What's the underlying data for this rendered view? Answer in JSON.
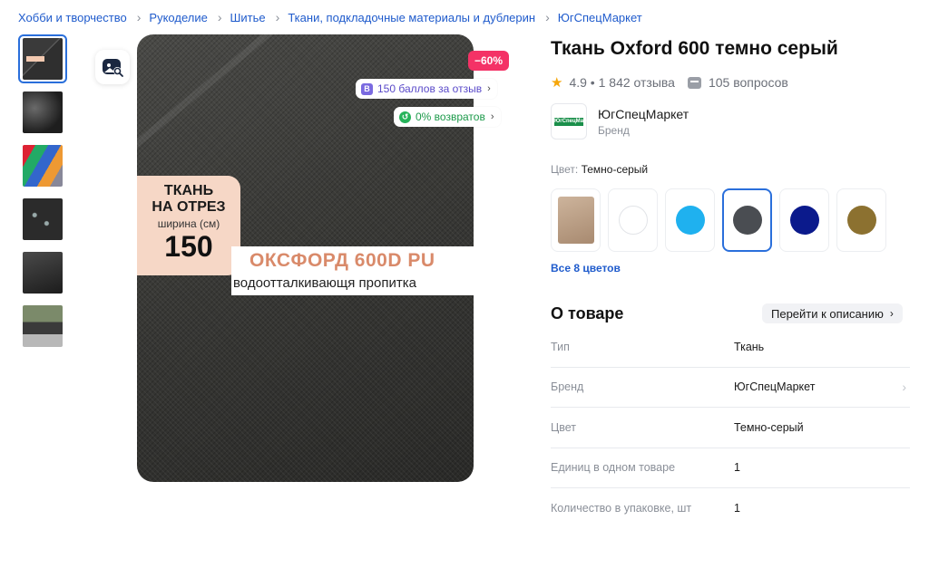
{
  "breadcrumb": [
    "Хобби и творчество",
    "Рукоделие",
    "Шитье",
    "Ткани, подкладочные материалы и дублерин",
    "ЮгСпецМаркет"
  ],
  "gallery": {
    "image_text": {
      "promo_line1": "ТКАНЬ",
      "promo_line2": "НА ОТРЕЗ",
      "promo_width_label": "ширина (см)",
      "promo_width_value": "150",
      "banner_title": "ОКСФОРД 600D PU",
      "banner_subtitle": "водоотталкивающя пропитка"
    },
    "discount": "−60%",
    "bonus_pill": "150 баллов за отзыв",
    "bonus_icon": "В",
    "returns_pill": "0% возвратов"
  },
  "product": {
    "title": "Ткань Oxford 600 темно серый",
    "rating": "4.9",
    "reviews": "1 842 отзыва",
    "questions": "105 вопросов",
    "brand_name": "ЮгСпецМаркет",
    "brand_sub": "Бренд",
    "brand_logo_text": "ЮгСпецМаркет"
  },
  "colors": {
    "label": "Цвет:",
    "selected": "Темно-серый",
    "swatches": [
      "#c9ab8f",
      "#ffffff",
      "#1fb1ef",
      "#4a4d52",
      "#0b1a8c",
      "#8c7130"
    ],
    "all_colors": "Все 8 цветов"
  },
  "about": {
    "title": "О товаре",
    "goto": "Перейти к описанию",
    "specs": [
      {
        "k": "Тип",
        "v": "Ткань"
      },
      {
        "k": "Бренд",
        "v": "ЮгСпецМаркет"
      },
      {
        "k": "Цвет",
        "v": "Темно-серый"
      },
      {
        "k": "Единиц в одном товаре",
        "v": "1"
      },
      {
        "k": "Количество в упаковке, шт",
        "v": "1"
      }
    ]
  }
}
